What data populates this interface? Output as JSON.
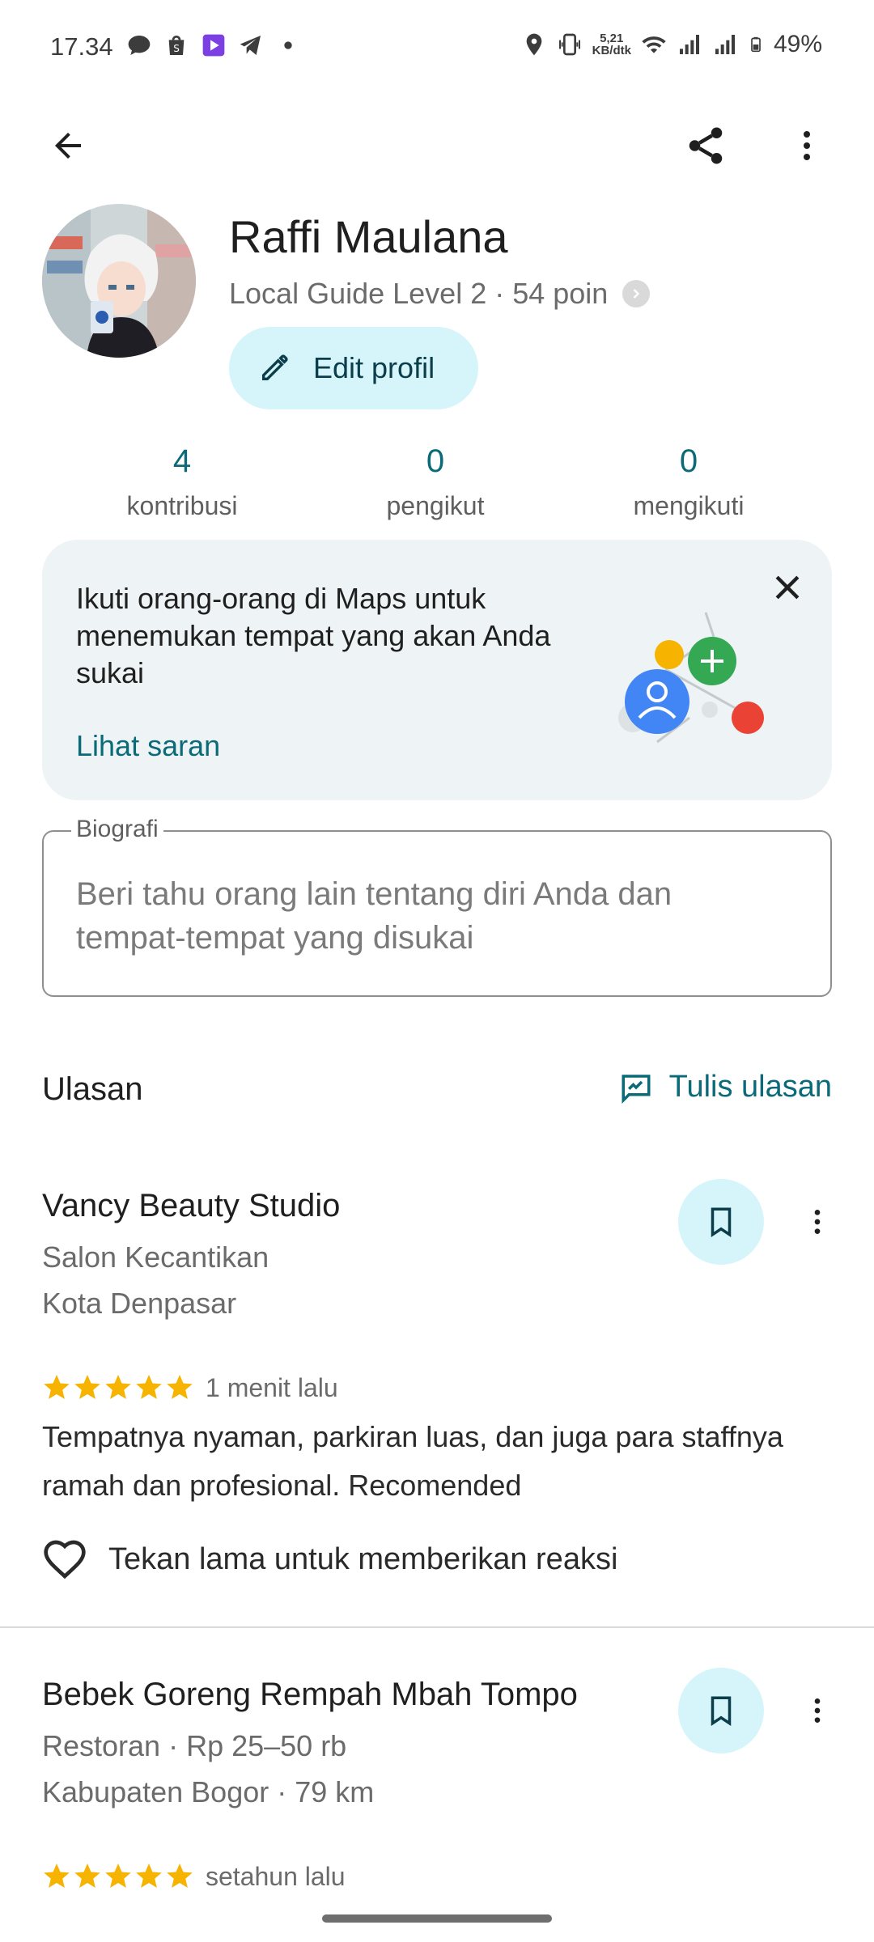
{
  "status_bar": {
    "time": "17.34",
    "net_speed_value": "5,21",
    "net_speed_unit": "KB/dtk",
    "battery_percent": "49%"
  },
  "top_bar": {
    "back_icon": "arrow-back-icon",
    "share_icon": "share-icon",
    "more_icon": "more-vert-icon"
  },
  "profile": {
    "name": "Raffi Maulana",
    "level": "Local Guide Level 2 · 54 poin",
    "edit_label": "Edit profil"
  },
  "stats": [
    {
      "value": "4",
      "label": "kontribusi"
    },
    {
      "value": "0",
      "label": "pengikut"
    },
    {
      "value": "0",
      "label": "mengikuti"
    }
  ],
  "suggestion": {
    "text": "Ikuti orang-orang di Maps untuk menemukan tempat yang akan Anda sukai",
    "link": "Lihat saran"
  },
  "bio": {
    "label": "Biografi",
    "placeholder": "Beri tahu orang lain tentang diri Anda dan tempat-tempat yang disukai"
  },
  "reviews": {
    "title": "Ulasan",
    "write_label": "Tulis ulasan",
    "items": [
      {
        "place": "Vancy Beauty Studio",
        "category": "Salon Kecantikan",
        "location": "Kota Denpasar",
        "rating": 5,
        "time": "1 menit lalu",
        "text": "Tempatnya nyaman, parkiran luas, dan juga para staffnya ramah dan profesional. Recomended",
        "react_label": "Tekan lama untuk memberikan reaksi"
      },
      {
        "place": "Bebek Goreng Rempah Mbah Tompo",
        "category": "Restoran · Rp 25–50 rb",
        "location": "Kabupaten Bogor · 79 km",
        "rating": 5,
        "time": "setahun lalu"
      }
    ]
  },
  "colors": {
    "accent": "#0b6a78",
    "chip_bg": "#d6f5fb",
    "card_bg": "#eef3f5",
    "star": "#f6b400"
  }
}
